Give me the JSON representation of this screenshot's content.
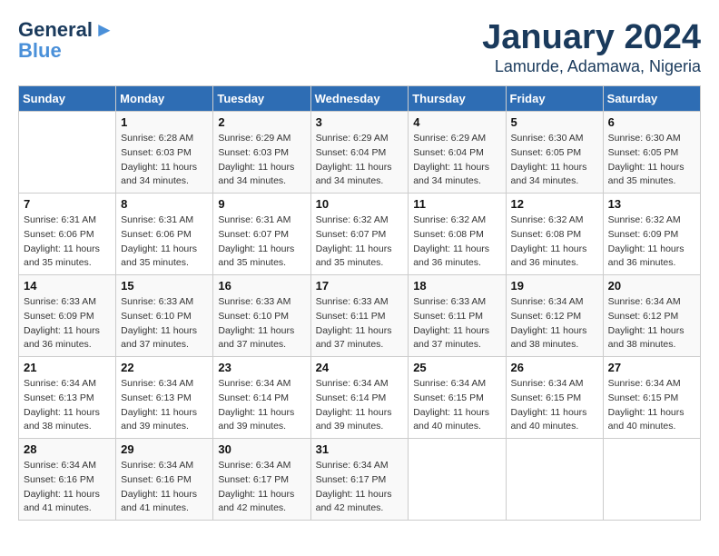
{
  "logo": {
    "line1": "General",
    "line2": "Blue"
  },
  "title": "January 2024",
  "subtitle": "Lamurde, Adamawa, Nigeria",
  "days_of_week": [
    "Sunday",
    "Monday",
    "Tuesday",
    "Wednesday",
    "Thursday",
    "Friday",
    "Saturday"
  ],
  "weeks": [
    [
      {
        "day": "",
        "sunrise": "",
        "sunset": "",
        "daylight": ""
      },
      {
        "day": "1",
        "sunrise": "Sunrise: 6:28 AM",
        "sunset": "Sunset: 6:03 PM",
        "daylight": "Daylight: 11 hours and 34 minutes."
      },
      {
        "day": "2",
        "sunrise": "Sunrise: 6:29 AM",
        "sunset": "Sunset: 6:03 PM",
        "daylight": "Daylight: 11 hours and 34 minutes."
      },
      {
        "day": "3",
        "sunrise": "Sunrise: 6:29 AM",
        "sunset": "Sunset: 6:04 PM",
        "daylight": "Daylight: 11 hours and 34 minutes."
      },
      {
        "day": "4",
        "sunrise": "Sunrise: 6:29 AM",
        "sunset": "Sunset: 6:04 PM",
        "daylight": "Daylight: 11 hours and 34 minutes."
      },
      {
        "day": "5",
        "sunrise": "Sunrise: 6:30 AM",
        "sunset": "Sunset: 6:05 PM",
        "daylight": "Daylight: 11 hours and 34 minutes."
      },
      {
        "day": "6",
        "sunrise": "Sunrise: 6:30 AM",
        "sunset": "Sunset: 6:05 PM",
        "daylight": "Daylight: 11 hours and 35 minutes."
      }
    ],
    [
      {
        "day": "7",
        "sunrise": "Sunrise: 6:31 AM",
        "sunset": "Sunset: 6:06 PM",
        "daylight": "Daylight: 11 hours and 35 minutes."
      },
      {
        "day": "8",
        "sunrise": "Sunrise: 6:31 AM",
        "sunset": "Sunset: 6:06 PM",
        "daylight": "Daylight: 11 hours and 35 minutes."
      },
      {
        "day": "9",
        "sunrise": "Sunrise: 6:31 AM",
        "sunset": "Sunset: 6:07 PM",
        "daylight": "Daylight: 11 hours and 35 minutes."
      },
      {
        "day": "10",
        "sunrise": "Sunrise: 6:32 AM",
        "sunset": "Sunset: 6:07 PM",
        "daylight": "Daylight: 11 hours and 35 minutes."
      },
      {
        "day": "11",
        "sunrise": "Sunrise: 6:32 AM",
        "sunset": "Sunset: 6:08 PM",
        "daylight": "Daylight: 11 hours and 36 minutes."
      },
      {
        "day": "12",
        "sunrise": "Sunrise: 6:32 AM",
        "sunset": "Sunset: 6:08 PM",
        "daylight": "Daylight: 11 hours and 36 minutes."
      },
      {
        "day": "13",
        "sunrise": "Sunrise: 6:32 AM",
        "sunset": "Sunset: 6:09 PM",
        "daylight": "Daylight: 11 hours and 36 minutes."
      }
    ],
    [
      {
        "day": "14",
        "sunrise": "Sunrise: 6:33 AM",
        "sunset": "Sunset: 6:09 PM",
        "daylight": "Daylight: 11 hours and 36 minutes."
      },
      {
        "day": "15",
        "sunrise": "Sunrise: 6:33 AM",
        "sunset": "Sunset: 6:10 PM",
        "daylight": "Daylight: 11 hours and 37 minutes."
      },
      {
        "day": "16",
        "sunrise": "Sunrise: 6:33 AM",
        "sunset": "Sunset: 6:10 PM",
        "daylight": "Daylight: 11 hours and 37 minutes."
      },
      {
        "day": "17",
        "sunrise": "Sunrise: 6:33 AM",
        "sunset": "Sunset: 6:11 PM",
        "daylight": "Daylight: 11 hours and 37 minutes."
      },
      {
        "day": "18",
        "sunrise": "Sunrise: 6:33 AM",
        "sunset": "Sunset: 6:11 PM",
        "daylight": "Daylight: 11 hours and 37 minutes."
      },
      {
        "day": "19",
        "sunrise": "Sunrise: 6:34 AM",
        "sunset": "Sunset: 6:12 PM",
        "daylight": "Daylight: 11 hours and 38 minutes."
      },
      {
        "day": "20",
        "sunrise": "Sunrise: 6:34 AM",
        "sunset": "Sunset: 6:12 PM",
        "daylight": "Daylight: 11 hours and 38 minutes."
      }
    ],
    [
      {
        "day": "21",
        "sunrise": "Sunrise: 6:34 AM",
        "sunset": "Sunset: 6:13 PM",
        "daylight": "Daylight: 11 hours and 38 minutes."
      },
      {
        "day": "22",
        "sunrise": "Sunrise: 6:34 AM",
        "sunset": "Sunset: 6:13 PM",
        "daylight": "Daylight: 11 hours and 39 minutes."
      },
      {
        "day": "23",
        "sunrise": "Sunrise: 6:34 AM",
        "sunset": "Sunset: 6:14 PM",
        "daylight": "Daylight: 11 hours and 39 minutes."
      },
      {
        "day": "24",
        "sunrise": "Sunrise: 6:34 AM",
        "sunset": "Sunset: 6:14 PM",
        "daylight": "Daylight: 11 hours and 39 minutes."
      },
      {
        "day": "25",
        "sunrise": "Sunrise: 6:34 AM",
        "sunset": "Sunset: 6:15 PM",
        "daylight": "Daylight: 11 hours and 40 minutes."
      },
      {
        "day": "26",
        "sunrise": "Sunrise: 6:34 AM",
        "sunset": "Sunset: 6:15 PM",
        "daylight": "Daylight: 11 hours and 40 minutes."
      },
      {
        "day": "27",
        "sunrise": "Sunrise: 6:34 AM",
        "sunset": "Sunset: 6:15 PM",
        "daylight": "Daylight: 11 hours and 40 minutes."
      }
    ],
    [
      {
        "day": "28",
        "sunrise": "Sunrise: 6:34 AM",
        "sunset": "Sunset: 6:16 PM",
        "daylight": "Daylight: 11 hours and 41 minutes."
      },
      {
        "day": "29",
        "sunrise": "Sunrise: 6:34 AM",
        "sunset": "Sunset: 6:16 PM",
        "daylight": "Daylight: 11 hours and 41 minutes."
      },
      {
        "day": "30",
        "sunrise": "Sunrise: 6:34 AM",
        "sunset": "Sunset: 6:17 PM",
        "daylight": "Daylight: 11 hours and 42 minutes."
      },
      {
        "day": "31",
        "sunrise": "Sunrise: 6:34 AM",
        "sunset": "Sunset: 6:17 PM",
        "daylight": "Daylight: 11 hours and 42 minutes."
      },
      {
        "day": "",
        "sunrise": "",
        "sunset": "",
        "daylight": ""
      },
      {
        "day": "",
        "sunrise": "",
        "sunset": "",
        "daylight": ""
      },
      {
        "day": "",
        "sunrise": "",
        "sunset": "",
        "daylight": ""
      }
    ]
  ]
}
